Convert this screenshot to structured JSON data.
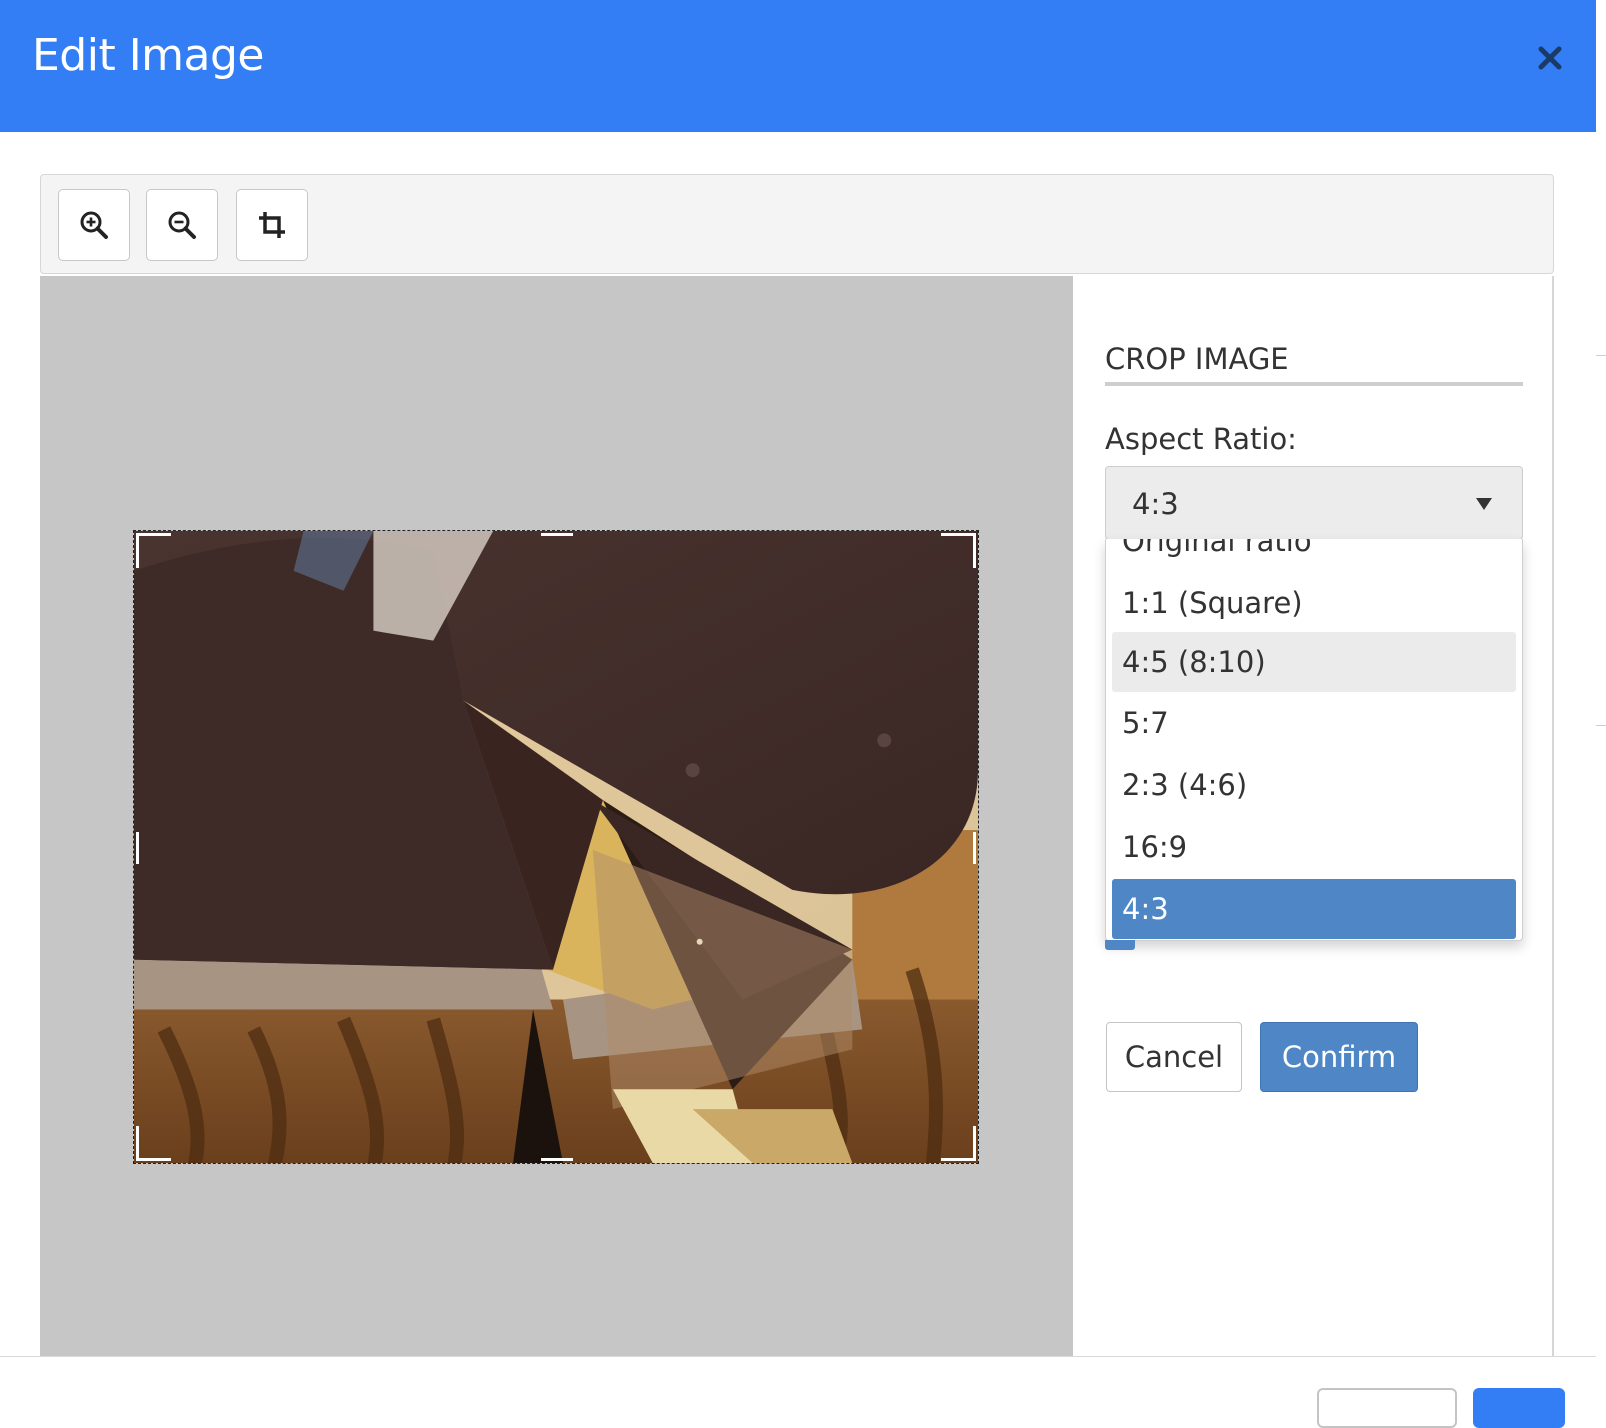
{
  "header": {
    "title": "Edit Image",
    "close_icon": "close-icon"
  },
  "toolbar": {
    "buttons": [
      {
        "name": "zoom-in",
        "icon": "zoom-in-icon"
      },
      {
        "name": "zoom-out",
        "icon": "zoom-out-icon"
      },
      {
        "name": "crop",
        "icon": "crop-icon"
      }
    ]
  },
  "crop_panel": {
    "section_title": "CROP IMAGE",
    "aspect_label": "Aspect Ratio:",
    "selected_value": "4:3",
    "options": [
      "Original ratio",
      "1:1 (Square)",
      "4:5 (8:10)",
      "5:7",
      "2:3 (4:6)",
      "16:9",
      "4:3"
    ],
    "hovered_option": "4:5 (8:10)",
    "cancel_label": "Cancel",
    "confirm_label": "Confirm"
  },
  "colors": {
    "header_bg": "#337ef4",
    "accent_button": "#4f86c6",
    "canvas_bg": "#c6c6c6"
  }
}
